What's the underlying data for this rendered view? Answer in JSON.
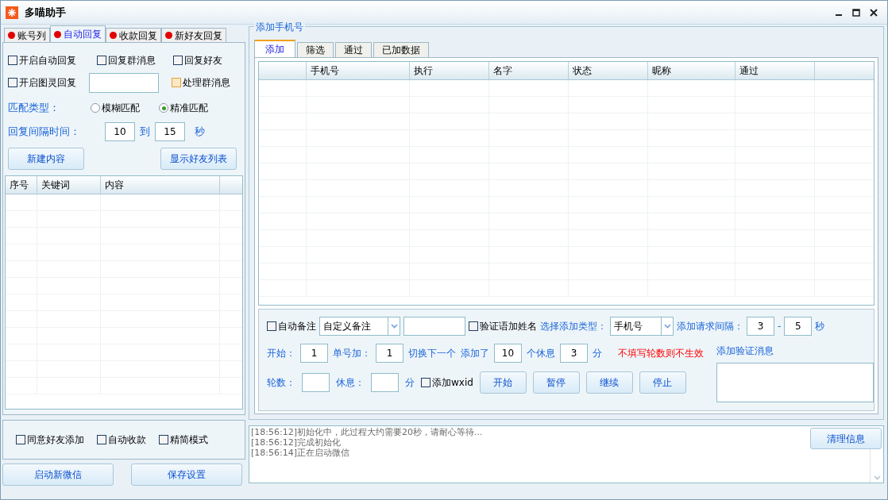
{
  "window": {
    "title": "多喵助手"
  },
  "left_tabs": [
    {
      "label": "账号列",
      "selected": false
    },
    {
      "label": "自动回复",
      "selected": true
    },
    {
      "label": "收款回复",
      "selected": false
    },
    {
      "label": "新好友回复",
      "selected": false
    }
  ],
  "auto_reply": {
    "options_row_1": [
      {
        "label": "开启自动回复",
        "checked": false,
        "hover": false
      },
      {
        "label": "回复群消息",
        "checked": false,
        "hover": false
      },
      {
        "label": "回复好友",
        "checked": false,
        "hover": false
      }
    ],
    "options_row_2": [
      {
        "label": "开启图灵回复",
        "checked": false,
        "hover": false
      },
      {
        "label": "处理群消息",
        "checked": false,
        "hover": true
      }
    ],
    "match_type": {
      "label": "匹配类型：",
      "options": [
        {
          "label": "模糊匹配",
          "selected": false
        },
        {
          "label": "精准匹配",
          "selected": true
        }
      ]
    },
    "interval": {
      "label": "回复间隔时间：",
      "from": "10",
      "to_label": "到",
      "to": "15",
      "unit": "秒"
    },
    "buttons": [
      "新建内容",
      "显示好友列表"
    ]
  },
  "keyword_table": {
    "columns": [
      "序号",
      "关键词",
      "内容"
    ]
  },
  "bottom_options": [
    {
      "label": "同意好友添加",
      "checked": false
    },
    {
      "label": "自动收款",
      "checked": false
    },
    {
      "label": "精简模式",
      "checked": false
    }
  ],
  "bottom_buttons": [
    "启动新微信",
    "保存设置"
  ],
  "add_phone": {
    "title": "添加手机号",
    "tabs": [
      {
        "label": "添加",
        "selected": true
      },
      {
        "label": "筛选",
        "selected": false
      },
      {
        "label": "通过",
        "selected": false
      },
      {
        "label": "已加数据",
        "selected": false
      }
    ],
    "table": {
      "columns": [
        "",
        "手机号",
        "执行",
        "名字",
        "状态",
        "昵称",
        "通过"
      ]
    },
    "row_1": [
      {
        "kind": "checkbox",
        "label": "自动备注",
        "checked": false
      },
      {
        "kind": "select",
        "value": "自定义备注"
      },
      {
        "kind": "input"
      },
      {
        "kind": "checkbox",
        "label": "验证语加姓名",
        "checked": false
      },
      {
        "kind": "label",
        "text": "选择添加类型："
      },
      {
        "kind": "select",
        "value": "手机号"
      },
      {
        "kind": "label",
        "text": "添加请求间隔："
      },
      {
        "kind": "input",
        "value": "3"
      },
      {
        "kind": "label",
        "text": "-"
      },
      {
        "kind": "input",
        "value": "5"
      },
      {
        "kind": "label",
        "text": "秒"
      }
    ],
    "row_2": [
      {
        "kind": "label",
        "text": "开始："
      },
      {
        "kind": "input",
        "value": "1"
      },
      {
        "kind": "label",
        "text": "单号加："
      },
      {
        "kind": "input",
        "value": "1"
      },
      {
        "kind": "label",
        "text": "切换下一个"
      },
      {
        "kind": "label",
        "text": "添加了"
      },
      {
        "kind": "input",
        "value": "10"
      },
      {
        "kind": "label",
        "text": "个休息"
      },
      {
        "kind": "input",
        "value": "3"
      },
      {
        "kind": "label",
        "text": "分"
      },
      {
        "kind": "warning",
        "text": "不填写轮数则不生效"
      }
    ],
    "row_3": [
      {
        "kind": "label",
        "text": "轮数："
      },
      {
        "kind": "input"
      },
      {
        "kind": "label",
        "text": "休息："
      },
      {
        "kind": "input"
      },
      {
        "kind": "label",
        "text": "分"
      },
      {
        "kind": "checkbox",
        "label": "添加wxid",
        "checked": false
      },
      {
        "kind": "button",
        "label": "开始"
      },
      {
        "kind": "button",
        "label": "暂停"
      },
      {
        "kind": "button",
        "label": "继续"
      },
      {
        "kind": "button",
        "label": "停止"
      }
    ],
    "verify_message": {
      "label": "添加验证消息"
    }
  },
  "log": {
    "lines": [
      "[18:56:12]初始化中，此过程大约需要20秒，请耐心等待...",
      "[18:56:12]完成初始化",
      "[18:56:14]正在启动微信"
    ],
    "clear_button": "清理信息"
  }
}
